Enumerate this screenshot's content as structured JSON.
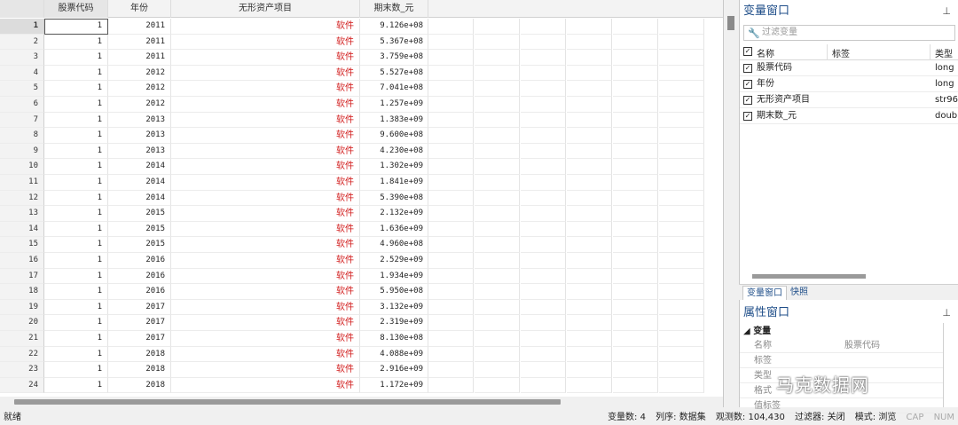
{
  "columns": [
    "股票代码",
    "年份",
    "无形资产项目",
    "期末数_元"
  ],
  "rows": [
    {
      "n": "1",
      "code": "1",
      "year": "2011",
      "item": "软件",
      "val": "9.126e+08"
    },
    {
      "n": "2",
      "code": "1",
      "year": "2011",
      "item": "软件",
      "val": "5.367e+08"
    },
    {
      "n": "3",
      "code": "1",
      "year": "2011",
      "item": "软件",
      "val": "3.759e+08"
    },
    {
      "n": "4",
      "code": "1",
      "year": "2012",
      "item": "软件",
      "val": "5.527e+08"
    },
    {
      "n": "5",
      "code": "1",
      "year": "2012",
      "item": "软件",
      "val": "7.041e+08"
    },
    {
      "n": "6",
      "code": "1",
      "year": "2012",
      "item": "软件",
      "val": "1.257e+09"
    },
    {
      "n": "7",
      "code": "1",
      "year": "2013",
      "item": "软件",
      "val": "1.383e+09"
    },
    {
      "n": "8",
      "code": "1",
      "year": "2013",
      "item": "软件",
      "val": "9.600e+08"
    },
    {
      "n": "9",
      "code": "1",
      "year": "2013",
      "item": "软件",
      "val": "4.230e+08"
    },
    {
      "n": "10",
      "code": "1",
      "year": "2014",
      "item": "软件",
      "val": "1.302e+09"
    },
    {
      "n": "11",
      "code": "1",
      "year": "2014",
      "item": "软件",
      "val": "1.841e+09"
    },
    {
      "n": "12",
      "code": "1",
      "year": "2014",
      "item": "软件",
      "val": "5.390e+08"
    },
    {
      "n": "13",
      "code": "1",
      "year": "2015",
      "item": "软件",
      "val": "2.132e+09"
    },
    {
      "n": "14",
      "code": "1",
      "year": "2015",
      "item": "软件",
      "val": "1.636e+09"
    },
    {
      "n": "15",
      "code": "1",
      "year": "2015",
      "item": "软件",
      "val": "4.960e+08"
    },
    {
      "n": "16",
      "code": "1",
      "year": "2016",
      "item": "软件",
      "val": "2.529e+09"
    },
    {
      "n": "17",
      "code": "1",
      "year": "2016",
      "item": "软件",
      "val": "1.934e+09"
    },
    {
      "n": "18",
      "code": "1",
      "year": "2016",
      "item": "软件",
      "val": "5.950e+08"
    },
    {
      "n": "19",
      "code": "1",
      "year": "2017",
      "item": "软件",
      "val": "3.132e+09"
    },
    {
      "n": "20",
      "code": "1",
      "year": "2017",
      "item": "软件",
      "val": "2.319e+09"
    },
    {
      "n": "21",
      "code": "1",
      "year": "2017",
      "item": "软件",
      "val": "8.130e+08"
    },
    {
      "n": "22",
      "code": "1",
      "year": "2018",
      "item": "软件",
      "val": "4.088e+09"
    },
    {
      "n": "23",
      "code": "1",
      "year": "2018",
      "item": "软件",
      "val": "2.916e+09"
    },
    {
      "n": "24",
      "code": "1",
      "year": "2018",
      "item": "软件",
      "val": "1.172e+09"
    }
  ],
  "var_panel": {
    "title": "变量窗口",
    "filter_placeholder": "过滤变量",
    "headers": {
      "name": "名称",
      "label": "标签",
      "type": "类型"
    },
    "vars": [
      {
        "name": "股票代码",
        "type": "long"
      },
      {
        "name": "年份",
        "type": "long"
      },
      {
        "name": "无形资产项目",
        "type": "str96"
      },
      {
        "name": "期末数_元",
        "type": "doub"
      }
    ],
    "tabs": [
      "变量窗口",
      "快照"
    ]
  },
  "prop_panel": {
    "title": "属性窗口",
    "group": "变量",
    "rows": [
      {
        "k": "名称",
        "v": "股票代码"
      },
      {
        "k": "标签",
        "v": ""
      },
      {
        "k": "类型",
        "v": ""
      },
      {
        "k": "格式",
        "v": ""
      },
      {
        "k": "值标签",
        "v": ""
      }
    ]
  },
  "watermark": "马克数据网",
  "status": {
    "left": "就绪",
    "vars": "变量数: 4",
    "order": "列序: 数据集",
    "obs": "观测数: 104,430",
    "filter": "过滤器: 关闭",
    "mode": "模式: 浏览",
    "cap": "CAP",
    "num": "NUM"
  },
  "colors": {
    "accent": "#1f4e89",
    "string_value": "#d11a1a"
  }
}
